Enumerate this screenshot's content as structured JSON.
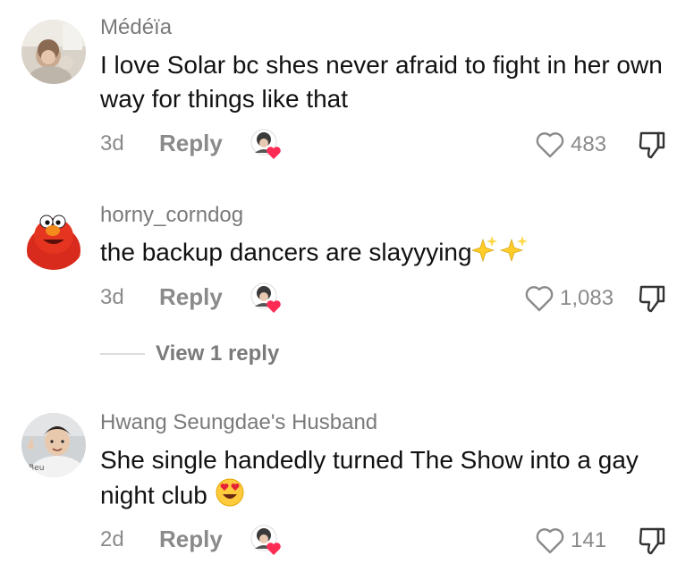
{
  "comments": [
    {
      "username": "Médéïa",
      "text": "I love Solar bc shes never afraid to fight in her own way for things like that",
      "time": "3d",
      "reply_label": "Reply",
      "likes": "483"
    },
    {
      "username": "horny_corndog",
      "text": "the backup dancers are slayyying",
      "text_emoji": "sparkles-icon",
      "time": "3d",
      "reply_label": "Reply",
      "likes": "1,083"
    },
    {
      "username": "Hwang Seungdae's Husband",
      "text": "She single handedly turned The Show into a gay night club",
      "text_emoji": "heart-eyes-icon",
      "time": "2d",
      "reply_label": "Reply",
      "likes": "141"
    }
  ],
  "view_replies": {
    "label": "View 1 reply"
  },
  "colors": {
    "text": "#111111",
    "secondary": "#8a8a8a",
    "divider": "#dcdcdc",
    "heart_red": "#fe2c55"
  }
}
